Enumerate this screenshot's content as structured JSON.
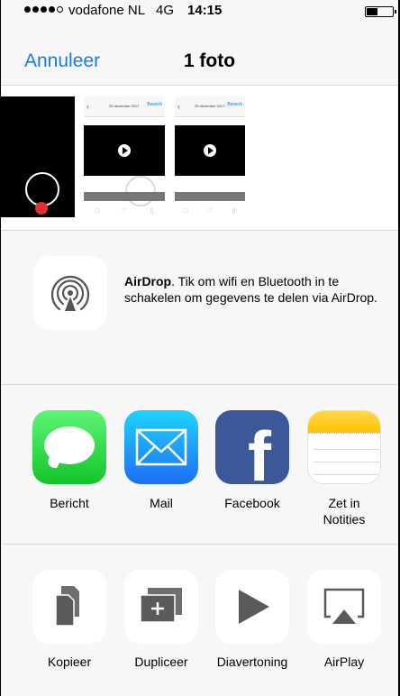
{
  "status_bar": {
    "carrier": "vodafone NL",
    "network": "4G",
    "time": "14:15",
    "signal_dots": 4
  },
  "nav": {
    "cancel_label": "Annuleer",
    "title": "1 foto"
  },
  "photos": {
    "thumb_date": "25 december 2017",
    "thumb_time": "14:14",
    "thumb_edit": "Bewerk",
    "selected_index": 2
  },
  "airdrop": {
    "title": "AirDrop",
    "description": ". Tik om wifi en Bluetooth in te schakelen om gegevens te delen via AirDrop."
  },
  "apps": [
    {
      "label": "Bericht",
      "icon": "messages-icon"
    },
    {
      "label": "Mail",
      "icon": "mail-icon"
    },
    {
      "label": "Facebook",
      "icon": "facebook-icon"
    },
    {
      "label": "Zet in Notities",
      "icon": "notes-icon"
    }
  ],
  "actions": [
    {
      "label": "Kopieer",
      "icon": "copy-icon"
    },
    {
      "label": "Dupliceer",
      "icon": "duplicate-icon"
    },
    {
      "label": "Diavertoning",
      "icon": "slideshow-icon"
    },
    {
      "label": "AirPlay",
      "icon": "airplay-icon"
    }
  ],
  "colors": {
    "accent": "#1a7ae6",
    "background": "#f7f7f7",
    "facebook": "#3b5998",
    "messages": "#21d039"
  }
}
